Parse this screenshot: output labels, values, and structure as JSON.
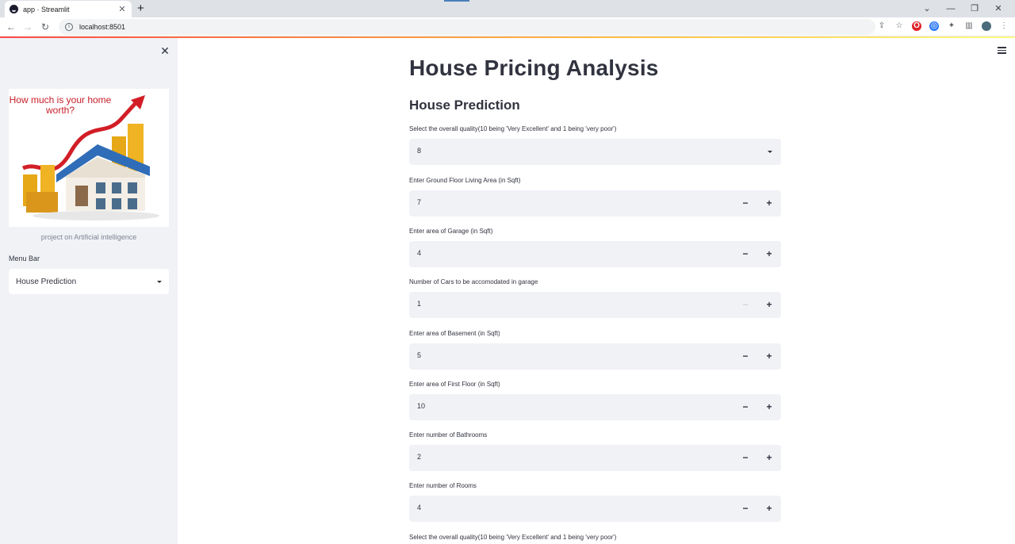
{
  "browser": {
    "tab_title": "app · Streamlit",
    "tab_close": "✕",
    "new_tab": "+",
    "url": "localhost:8501",
    "window_controls": [
      "⌄",
      "—",
      "❐",
      "✕"
    ]
  },
  "sidebar": {
    "close": "✕",
    "image_caption": "How much is your home worth?",
    "subtitle": "project on Artificial intelligence",
    "menu_label": "Menu Bar",
    "menu_value": "House Prediction"
  },
  "main": {
    "title": "House Pricing Analysis",
    "section": "House Prediction",
    "fields": [
      {
        "label": "Select the overall quality(10 being 'Very Excellent' and 1 being 'very poor')",
        "value": "8"
      },
      {
        "label": "Enter Ground Floor Living Area (in Sqft)",
        "value": "7"
      },
      {
        "label": "Enter area of Garage (in Sqft)",
        "value": "4"
      },
      {
        "label": "Number of Cars to be accomodated in garage",
        "value": "1"
      },
      {
        "label": "Enter area of Basement (in Sqft)",
        "value": "5"
      },
      {
        "label": "Enter area of First Floor (in Sqft)",
        "value": "10"
      },
      {
        "label": "Enter number of Bathrooms",
        "value": "2"
      },
      {
        "label": "Enter number of Rooms",
        "value": "4"
      },
      {
        "label": "Select the overall quality(10 being 'Very Excellent' and 1 being 'very poor')"
      }
    ],
    "minus": "−",
    "plus": "+"
  }
}
